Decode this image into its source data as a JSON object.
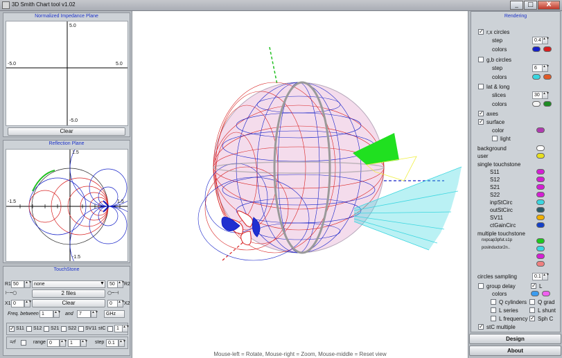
{
  "window": {
    "title": "3D Smith Chart tool v1.02",
    "minimize": "_",
    "maximize": "□",
    "close": "X"
  },
  "left": {
    "impedance": {
      "title": "Normalized Impedance Plane",
      "ticks": {
        "top": "5.0",
        "left": "-5.0",
        "right": "5.0",
        "bottom": "-5.0"
      },
      "clear": "Clear"
    },
    "reflection": {
      "title": "Reflection Plane",
      "ticks": {
        "top": "1.5",
        "left": "-1.5",
        "right": "1.5",
        "bottom": "-1.5"
      }
    },
    "touchstone": {
      "title": "TouchStone",
      "r1_label": "R1",
      "r1_value": "50",
      "r2_label": "R2",
      "r2_value": "50",
      "file_select": "none",
      "files_button": "2 files",
      "x1_label": "X1",
      "x1_value": "0",
      "x2_label": "X2",
      "x2_value": "0",
      "clear": "Clear",
      "freq_label": "Freq. between",
      "freq_from": "1",
      "and_label": "and",
      "freq_to": "7",
      "freq_unit": "GHz",
      "params": [
        {
          "label": "S11",
          "checked": true
        },
        {
          "label": "S12",
          "checked": false
        },
        {
          "label": "S21",
          "checked": false
        },
        {
          "label": "S22",
          "checked": false
        },
        {
          "label": "SV11",
          "checked": false
        }
      ],
      "stc_label": "stC",
      "stc_value": "1",
      "rf_label": "=rf",
      "range_label": "range",
      "range_from": "0",
      "range_to": "1",
      "step_label": "step",
      "step_value": "0.1"
    }
  },
  "status": "Mouse-left = Rotate, Mouse-right = Zoom, Mouse-middle = Reset view",
  "rendering": {
    "title": "Rendering",
    "rx": {
      "label": "r,x circles",
      "checked": true,
      "step_label": "step",
      "step": "0.4",
      "colors_label": "colors",
      "colors": [
        "#1420c8",
        "#d81e1e"
      ]
    },
    "gb": {
      "label": "g,b circles",
      "checked": false,
      "step_label": "step",
      "step": "6",
      "colors_label": "colors",
      "colors": [
        "#3ad6e0",
        "#e05a28"
      ]
    },
    "latlong": {
      "label": "lat & long",
      "checked": false,
      "slices_label": "slices",
      "slices": "30",
      "colors_label": "colors",
      "colors": [
        "#f4f4f4",
        "#1e8c24"
      ]
    },
    "axes": {
      "label": "axes",
      "checked": true
    },
    "surface": {
      "label": "surface",
      "checked": true,
      "color_label": "color",
      "color": "#b03ab0",
      "light_label": "light",
      "light": false
    },
    "background": {
      "label": "background",
      "color": "#ffffff"
    },
    "user": {
      "label": "user",
      "color": "#e8e01e"
    },
    "single": {
      "label": "single touchstone",
      "items": [
        {
          "label": "S11",
          "color": "#d41ed4"
        },
        {
          "label": "S12",
          "color": "#d41ed4"
        },
        {
          "label": "S21",
          "color": "#d41ed4"
        },
        {
          "label": "S22",
          "color": "#d41ed4"
        },
        {
          "label": "inpStCirc",
          "color": "#3ad6e0"
        },
        {
          "label": "outStCirc",
          "color": "#2a5a6a"
        },
        {
          "label": "SV11",
          "color": "#f0b000"
        },
        {
          "label": "ctGainCirc",
          "color": "#1440c8"
        }
      ]
    },
    "multiple": {
      "label": "multiple touchstone",
      "items": [
        {
          "label": "nxpcap3pfut.s1p",
          "color": "#1ec81e"
        },
        {
          "label": "poslnductor2n..",
          "color": "#3ad6e0"
        },
        {
          "label": "",
          "color": "#d41ed4"
        },
        {
          "label": "",
          "color": "#f08080"
        }
      ]
    },
    "sampling": {
      "label": "circles sampling",
      "value": "0.1"
    },
    "group_delay": {
      "label": "group delay",
      "checked": false
    },
    "L": {
      "label": "L",
      "checked": true
    },
    "colors_label": "colors",
    "pair_colors": [
      "#3a9cf0",
      "#f060f0"
    ],
    "q_cyl": {
      "label": "Q cylinders",
      "checked": false
    },
    "q_grad": {
      "label": "Q grad",
      "checked": false
    },
    "l_series": {
      "label": "L series",
      "checked": false
    },
    "l_shunt": {
      "label": "L shunt",
      "checked": false
    },
    "l_freq": {
      "label": "L frequency",
      "checked": false
    },
    "sph_c": {
      "label": "Sph C",
      "checked": true
    },
    "stc_multiple": {
      "label": "stC multiple",
      "checked": true
    }
  },
  "buttons": {
    "design": "Design",
    "about": "About"
  }
}
